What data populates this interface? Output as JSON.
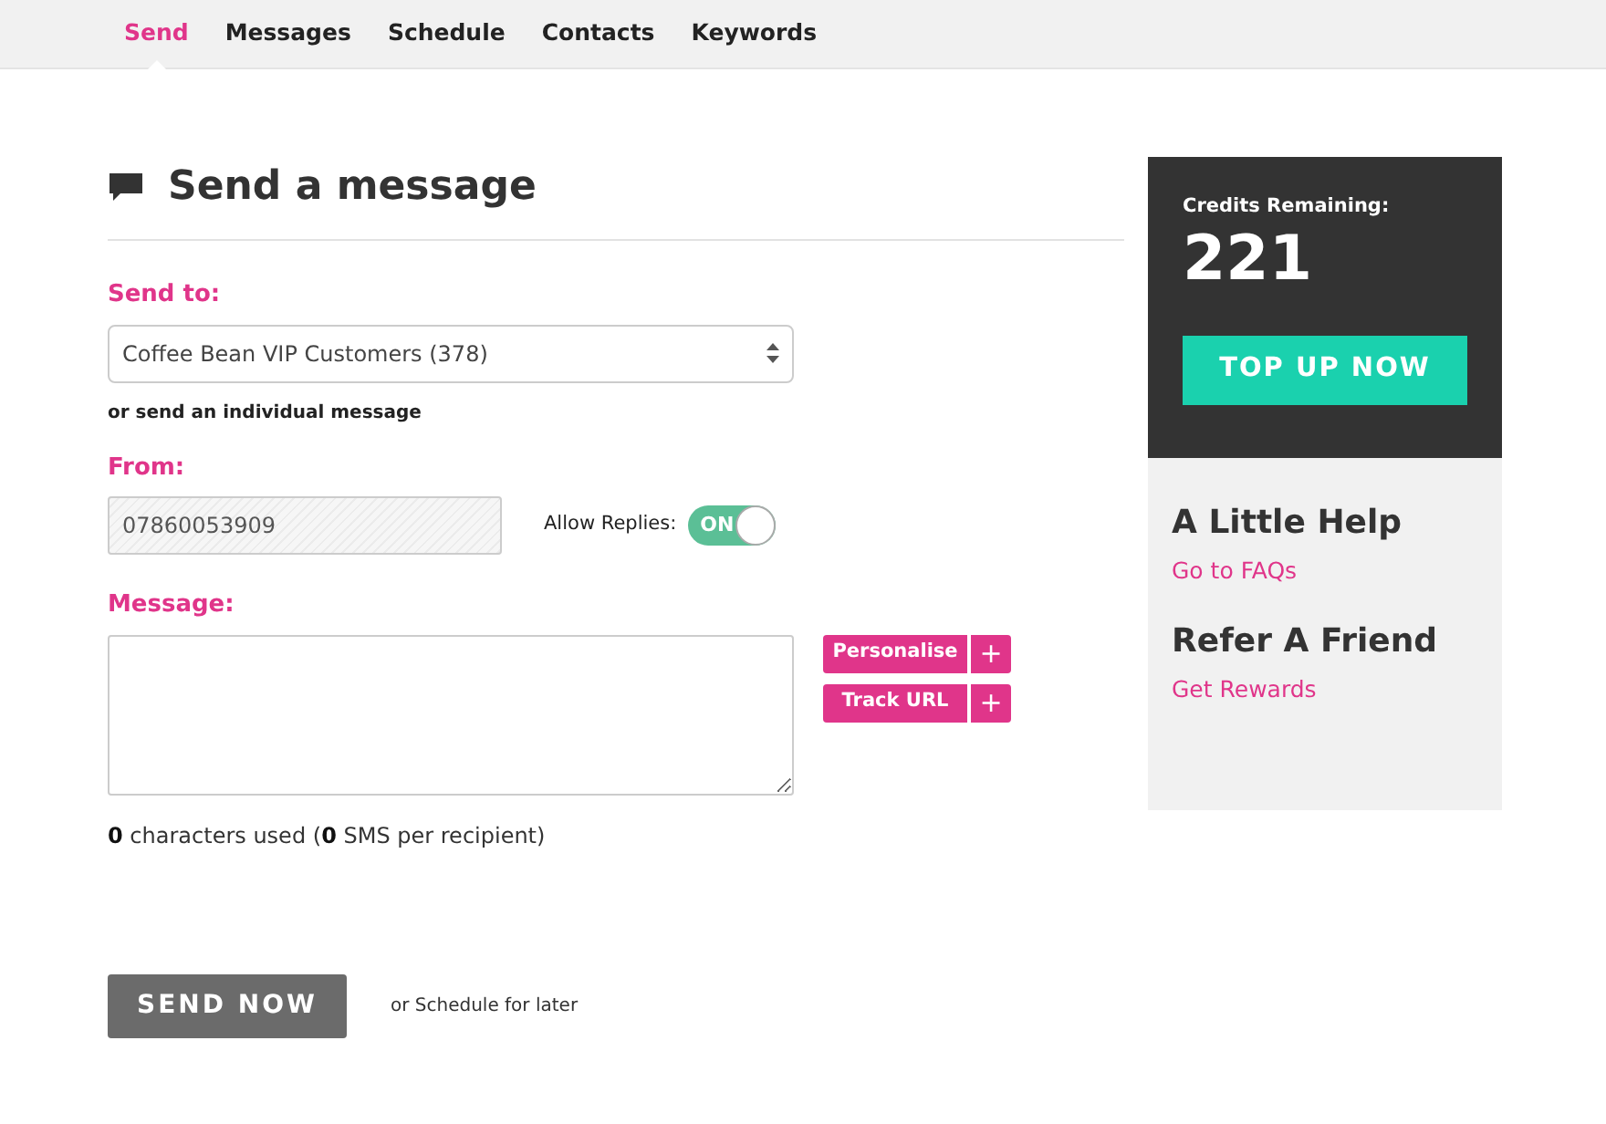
{
  "nav": {
    "tabs": [
      {
        "label": "Send",
        "selected": true
      },
      {
        "label": "Messages",
        "selected": false
      },
      {
        "label": "Schedule",
        "selected": false
      },
      {
        "label": "Contacts",
        "selected": false
      },
      {
        "label": "Keywords",
        "selected": false
      }
    ]
  },
  "page": {
    "title": "Send a message"
  },
  "send_to": {
    "label": "Send to:",
    "value": "Coffee Bean VIP Customers (378)",
    "alt_link": "or send an individual message"
  },
  "from": {
    "label": "From:",
    "value": "07860053909",
    "disabled": true,
    "allow_replies": {
      "label": "Allow Replies:",
      "on": true,
      "state_text": "ON"
    }
  },
  "message": {
    "label": "Message:",
    "insert_buttons": [
      {
        "label": "Personalise",
        "plus": "+"
      },
      {
        "label": "Track URL",
        "plus": "+"
      }
    ],
    "count": "**0** characters used (**0** SMS per recipient)"
  },
  "actions": {
    "send": "SEND NOW",
    "schedule": "or Schedule for later"
  },
  "sidebar": {
    "credits_label": "Credits Remaining:",
    "credits": "221",
    "top_up": "TOP UP NOW",
    "sections": [
      {
        "heading": "A Little Help",
        "link": "Go to FAQs"
      },
      {
        "heading": "Refer A Friend",
        "link": "Get Rewards"
      }
    ]
  }
}
